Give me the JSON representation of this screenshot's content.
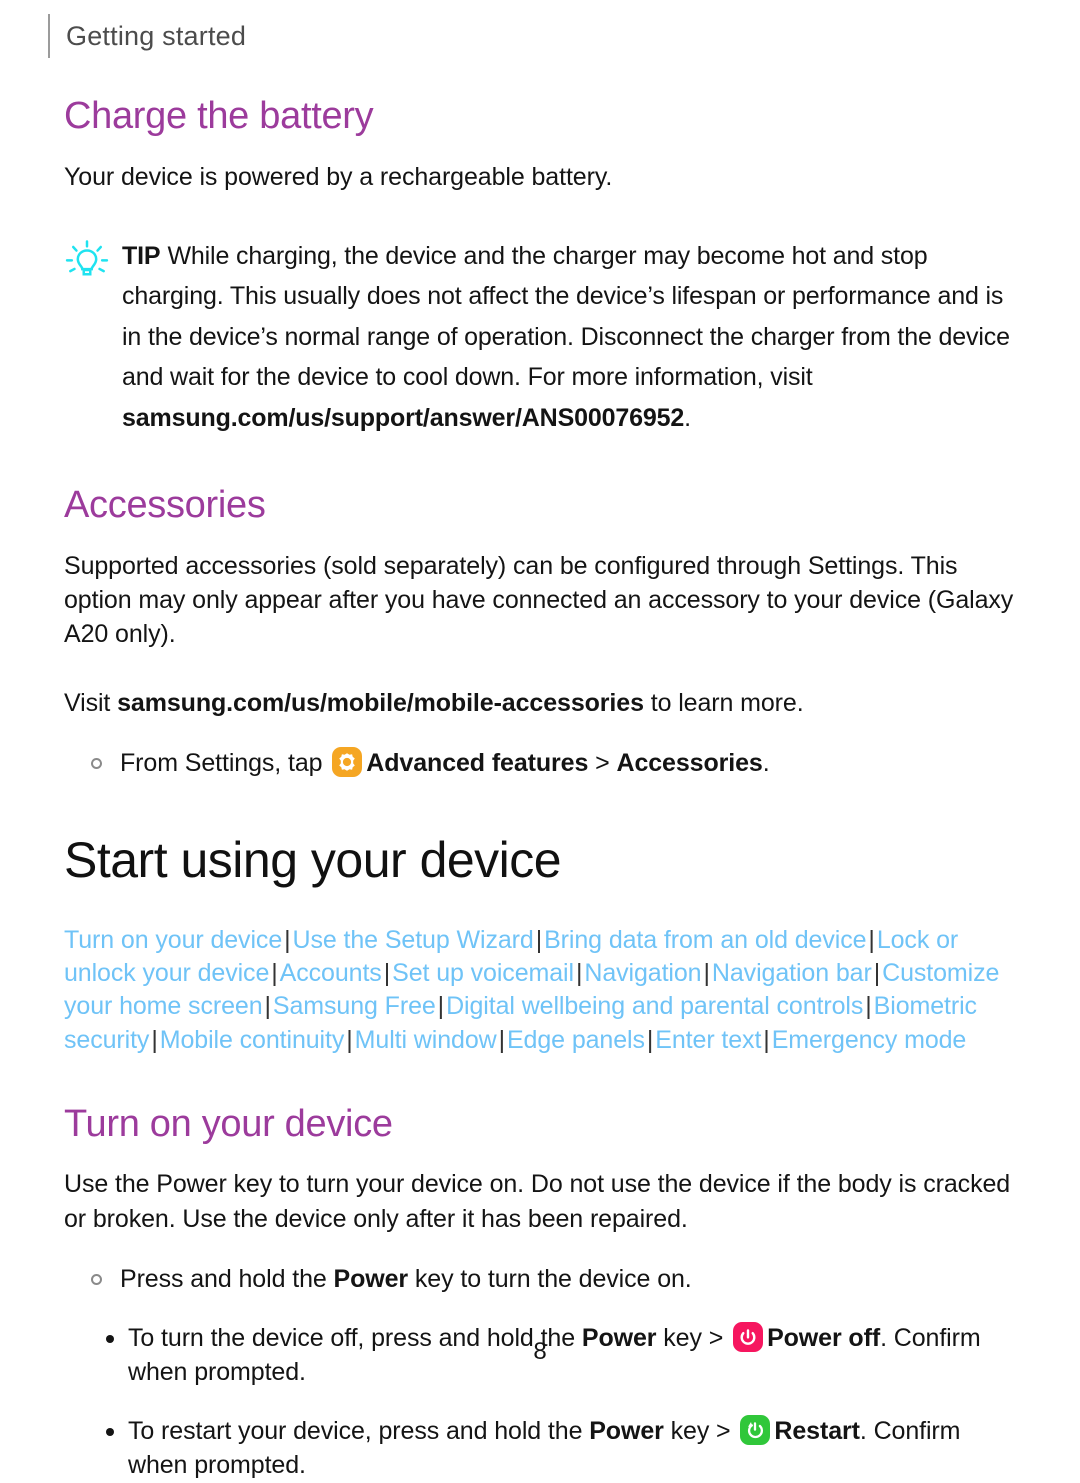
{
  "header": {
    "title": "Getting started"
  },
  "charge": {
    "heading": "Charge the battery",
    "intro": "Your device is powered by a rechargeable battery.",
    "tip": {
      "icon": "lightbulb-icon",
      "icon_color": "#1fe3f0",
      "label": "TIP",
      "text_before_link": "While charging, the device and the charger may become hot and stop charging. This usually does not affect the device’s lifespan or performance and is in the device’s normal range of operation. Disconnect the charger from the device and wait for the device to cool down. For more information, visit ",
      "link": "samsung.com/us/support/answer/ANS00076952",
      "text_after_link": "."
    }
  },
  "accessories": {
    "heading": "Accessories",
    "paragraph": "Supported accessories (sold separately) can be configured through Settings. This option may only appear after you have connected an accessory to your device (Galaxy A20 only).",
    "visit_prefix": "Visit ",
    "visit_link": "samsung.com/us/mobile/mobile-accessories",
    "visit_suffix": " to learn more.",
    "step": {
      "prefix": "From Settings, tap ",
      "icon": "settings-gear-icon",
      "icon_color": "#f5a623",
      "bold_target": "Advanced features",
      "separator": " > ",
      "bold_target2": "Accessories",
      "suffix": "."
    }
  },
  "start_using": {
    "heading": "Start using your device",
    "links": [
      "Turn on your device",
      "Use the Setup Wizard",
      "Bring data from an old device",
      "Lock or unlock your device",
      "Accounts",
      "Set up voicemail",
      "Navigation",
      "Navigation bar",
      "Customize your home screen",
      "Samsung Free",
      "Digital wellbeing and parental controls",
      "Biometric security",
      "Mobile continuity",
      "Multi window",
      "Edge panels",
      "Enter text",
      "Emergency mode"
    ],
    "link_color": "#6fc3f7",
    "separator": "|"
  },
  "turn_on": {
    "heading": "Turn on your device",
    "paragraph": "Use the Power key to turn your device on. Do not use the device if the body is cracked or broken. Use the device only after it has been repaired.",
    "main_step": {
      "prefix": "Press and hold the ",
      "bold": "Power",
      "suffix": " key to turn the device on."
    },
    "sub_steps": [
      {
        "prefix": "To turn the device off, press and hold the ",
        "bold": "Power",
        "mid": " key > ",
        "icon": "power-off-icon",
        "icon_color": "#f6165f",
        "bold_action": "Power off",
        "suffix": ". Confirm when prompted."
      },
      {
        "prefix": "To restart your device, press and hold the ",
        "bold": "Power",
        "mid": " key > ",
        "icon": "restart-icon",
        "icon_color": "#30c73a",
        "bold_action": "Restart",
        "suffix": ". Confirm when prompted."
      }
    ]
  },
  "footer": {
    "page_number": "8"
  },
  "theme": {
    "heading_purple": "#9c3b9c",
    "link_blue": "#6fc3f7",
    "text_black": "#141414",
    "header_gray": "#4c4c4c"
  }
}
